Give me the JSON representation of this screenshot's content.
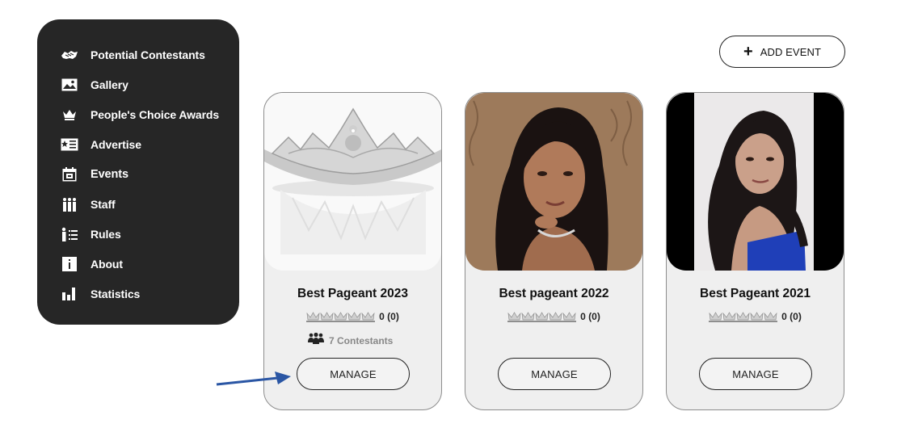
{
  "sidebar": {
    "items": [
      {
        "label": "Potential Contestants",
        "icon": "handshake-icon"
      },
      {
        "label": "Gallery",
        "icon": "image-icon"
      },
      {
        "label": "People's Choice Awards",
        "icon": "crown-icon"
      },
      {
        "label": "Advertise",
        "icon": "ad-card-icon"
      },
      {
        "label": "Events",
        "icon": "calendar-icon",
        "active": true
      },
      {
        "label": "Staff",
        "icon": "people-icon"
      },
      {
        "label": "Rules",
        "icon": "rules-list-icon"
      },
      {
        "label": "About",
        "icon": "info-icon"
      },
      {
        "label": "Statistics",
        "icon": "bar-chart-icon"
      }
    ]
  },
  "header": {
    "add_event_label": "ADD EVENT"
  },
  "events": [
    {
      "title": "Best Pageant 2023",
      "rating": "0 (0)",
      "contestants": "7 Contestants",
      "manage_label": "MANAGE",
      "image": "tiara-photo"
    },
    {
      "title": "Best pageant 2022",
      "rating": "0 (0)",
      "manage_label": "MANAGE",
      "image": "contestant-photo"
    },
    {
      "title": "Best Pageant 2021",
      "rating": "0 (0)",
      "manage_label": "MANAGE",
      "image": "contestant-photo"
    }
  ],
  "colors": {
    "sidebar_bg": "#262626",
    "card_bg": "#efefef",
    "arrow": "#2a56a4"
  }
}
